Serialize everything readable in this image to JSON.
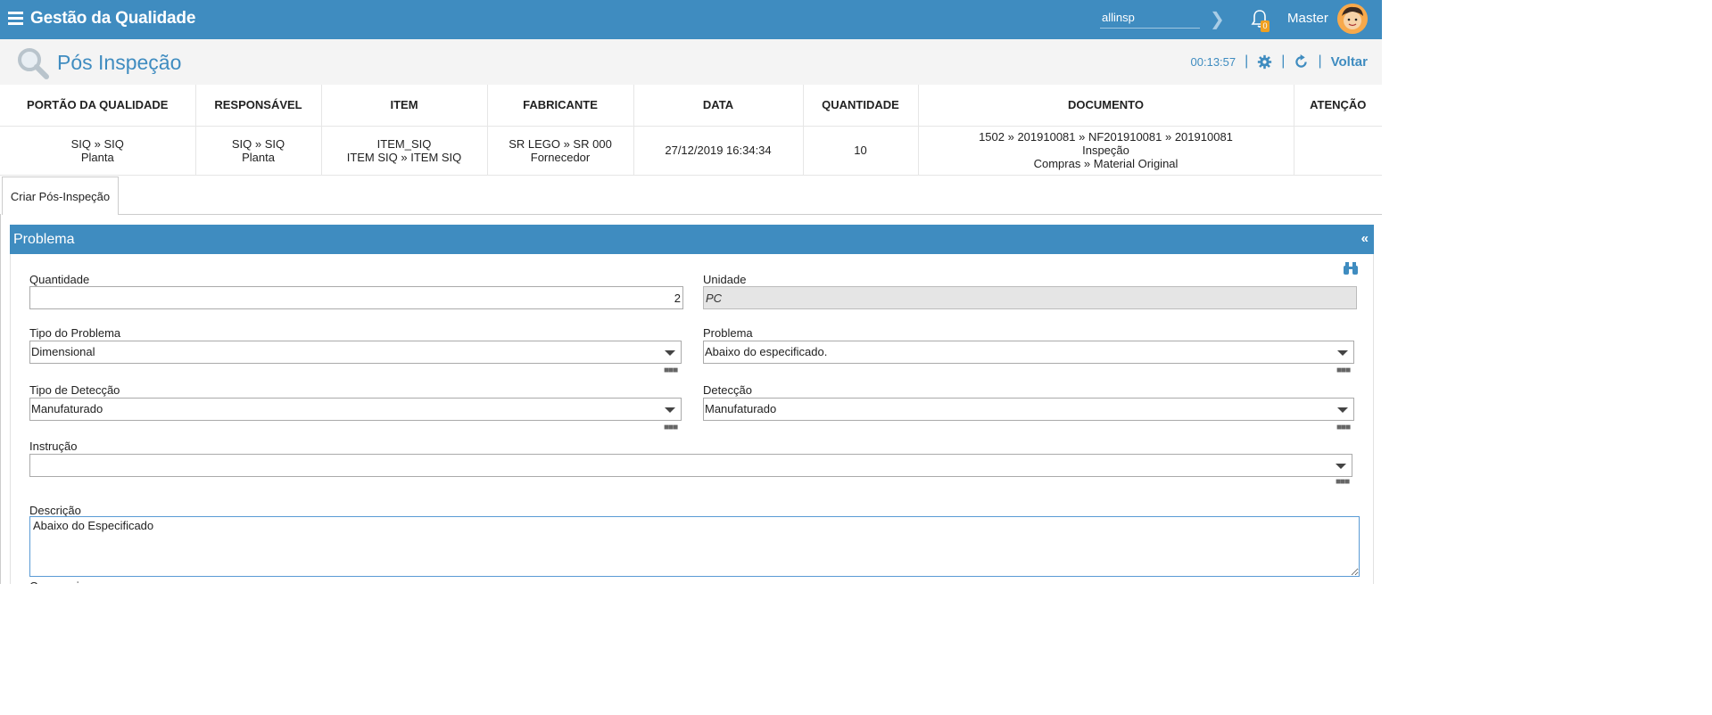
{
  "header": {
    "app_title": "Gestão da Qualidade",
    "user_field_value": "allinsp",
    "notification_count": "0",
    "user_name": "Master"
  },
  "page": {
    "title": "Pós Inspeção",
    "timer": "00:13:57",
    "back_label": "Voltar"
  },
  "info_table": {
    "headers": [
      "PORTÃO DA QUALIDADE",
      "RESPONSÁVEL",
      "ITEM",
      "FABRICANTE",
      "DATA",
      "QUANTIDADE",
      "DOCUMENTO",
      "ATENÇÃO"
    ],
    "row": {
      "portao": [
        "SIQ » SIQ",
        "Planta"
      ],
      "responsavel": [
        "SIQ » SIQ",
        "Planta"
      ],
      "item": [
        "ITEM_SIQ",
        "ITEM SIQ » ITEM SIQ"
      ],
      "fabricante": [
        "SR LEGO » SR 000",
        "Fornecedor"
      ],
      "data": "27/12/2019 16:34:34",
      "quantidade": "10",
      "documento": [
        "1502 » 201910081 » NF201910081 » 201910081",
        "Inspeção",
        "Compras » Material Original"
      ],
      "atencao": ""
    }
  },
  "tabs": [
    {
      "label": "Criar Pós-Inspeção"
    }
  ],
  "section": {
    "title": "Problema",
    "collapse_glyph": "«"
  },
  "form": {
    "quantidade": {
      "label": "Quantidade",
      "value": "2"
    },
    "unidade": {
      "label": "Unidade",
      "value": "PC"
    },
    "tipo_problema": {
      "label": "Tipo do Problema",
      "value": "Dimensional"
    },
    "problema": {
      "label": "Problema",
      "value": "Abaixo do especificado."
    },
    "tipo_deteccao": {
      "label": "Tipo de Detecção",
      "value": "Manufaturado"
    },
    "deteccao": {
      "label": "Detecção",
      "value": "Manufaturado"
    },
    "instrucao": {
      "label": "Instrução",
      "value": ""
    },
    "descricao": {
      "label": "Descrição",
      "value": "Abaixo do Especificado"
    },
    "next_label_partial": "Causa raiz"
  },
  "colors": {
    "primary": "#3f8cc0",
    "badge": "#f0a020",
    "page_bg": "#f4f4f4"
  },
  "icons": [
    "menu-icon",
    "chevron-right-icon",
    "bell-icon",
    "avatar",
    "search-icon",
    "gear-icon",
    "refresh-icon",
    "binoculars-icon",
    "caret-down-icon",
    "more-icon"
  ]
}
